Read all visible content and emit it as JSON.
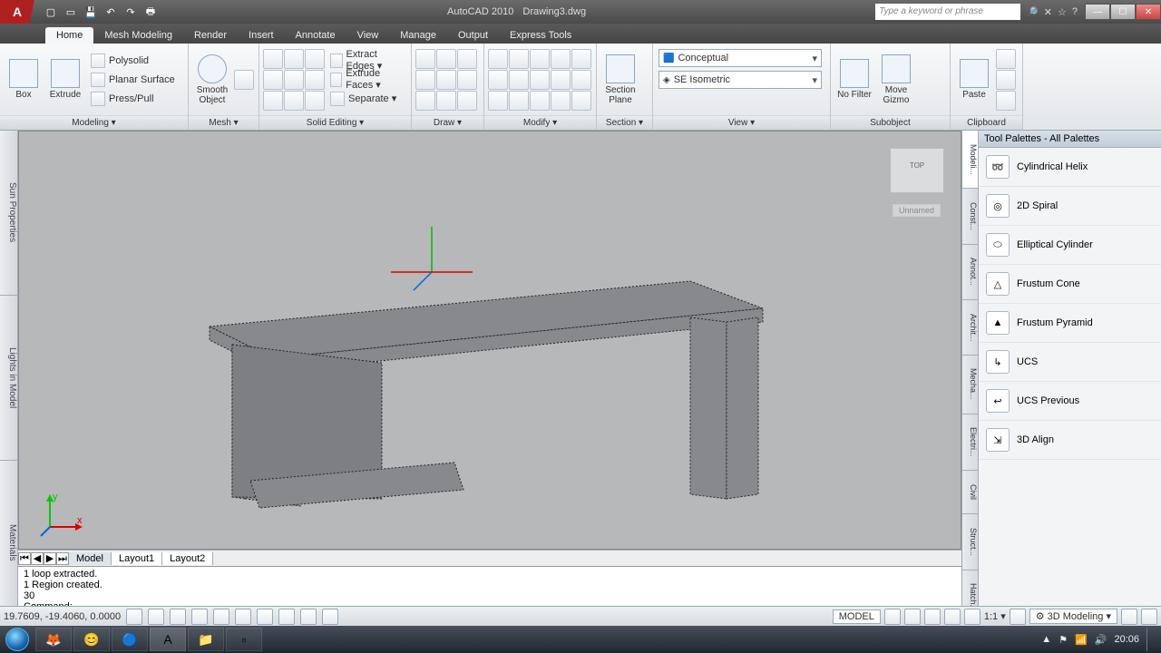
{
  "title": {
    "app": "AutoCAD 2010",
    "doc": "Drawing3.dwg"
  },
  "search_placeholder": "Type a keyword or phrase",
  "tabs": [
    "Home",
    "Mesh Modeling",
    "Render",
    "Insert",
    "Annotate",
    "View",
    "Manage",
    "Output",
    "Express Tools"
  ],
  "active_tab": "Home",
  "panels": {
    "modeling": {
      "title": "Modeling ▾",
      "box": "Box",
      "extrude": "Extrude",
      "items": [
        "Polysolid",
        "Planar Surface",
        "Press/Pull"
      ]
    },
    "mesh": {
      "title": "Mesh    ▾",
      "smooth": "Smooth\nObject"
    },
    "solid": {
      "title": "Solid Editing ▾",
      "items": [
        "Extract Edges ▾",
        "Extrude Faces ▾",
        "Separate ▾"
      ]
    },
    "draw": {
      "title": "Draw ▾"
    },
    "modify": {
      "title": "Modify ▾"
    },
    "section": {
      "title": "Section ▾",
      "btn": "Section\nPlane"
    },
    "view": {
      "title": "View ▾",
      "style": "Conceptual",
      "iso": "SE Isometric"
    },
    "subobject": {
      "title": "Subobject",
      "nofilter": "No Filter",
      "gizmo": "Move Gizmo"
    },
    "clipboard": {
      "title": "Clipboard",
      "paste": "Paste"
    }
  },
  "left_tabs": [
    "Sun Properties",
    "Lights in Model",
    "Materials"
  ],
  "viewcube": {
    "face": "TOP",
    "label": "Unnamed"
  },
  "model_tabs": [
    "Model",
    "Layout1",
    "Layout2"
  ],
  "cmd": {
    "l1": "1 loop extracted.",
    "l2": "1 Region created.",
    "l3": "30",
    "prompt": "Command:"
  },
  "palette": {
    "title": "Tool Palettes - All Palettes",
    "tabs": [
      "Modeli...",
      "Const...",
      "Annot...",
      "Archit...",
      "Mecha...",
      "Electri...",
      "Civil",
      "Struct...",
      "Hatch..."
    ],
    "items": [
      "Cylindrical Helix",
      "2D Spiral",
      "Elliptical Cylinder",
      "Frustum Cone",
      "Frustum Pyramid",
      "UCS",
      "UCS Previous",
      "3D Align"
    ]
  },
  "coords": "19.7609, -19.4060, 0.0000",
  "status": {
    "model": "MODEL",
    "scale": "1:1 ▾",
    "ws": "3D Modeling ▾"
  },
  "clock": "20:06"
}
